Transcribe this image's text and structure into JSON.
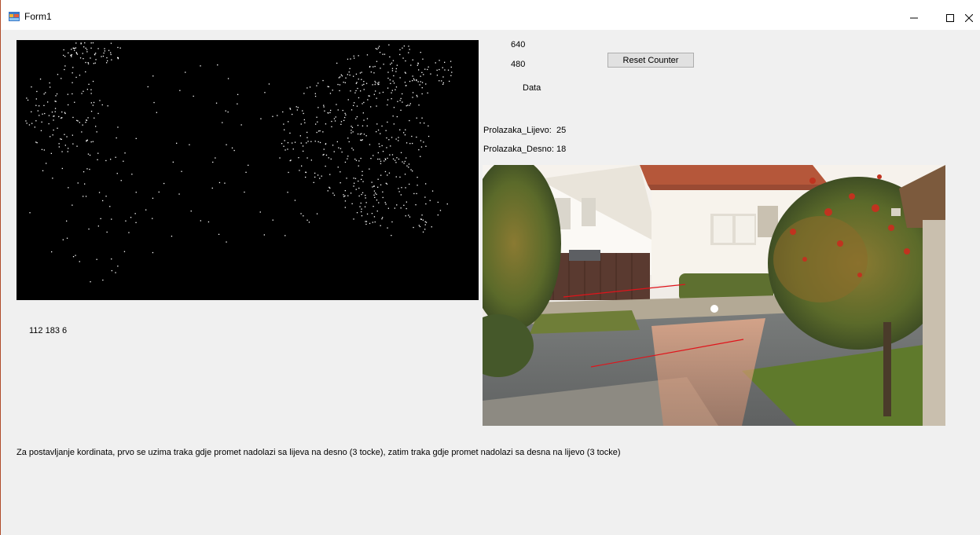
{
  "window": {
    "title": "Form1",
    "controls": {
      "minimize": "minimize-icon",
      "maximize": "maximize-icon",
      "close": "close-icon"
    }
  },
  "labels": {
    "width_value": "640",
    "height_value": "480",
    "data_label": "Data",
    "left_count_label": "Prolazaka_Lijevo:",
    "left_count_value": "25",
    "right_count_label": "Prolazaka_Desno:",
    "right_count_value": "18",
    "coords_value": "112 183 6",
    "instructions": "Za postavljanje kordinata, prvo se uzima traka gdje promet nadolazi sa lijeva na desno (3 tocke), zatim traka gdje promet nadolazi sa desna na lijevo (3 tocke)"
  },
  "buttons": {
    "reset_counter": "Reset Counter"
  },
  "colors": {
    "lane_line": "#e0141b",
    "motion_background": "#000000",
    "window_border": "#b04d2a"
  }
}
